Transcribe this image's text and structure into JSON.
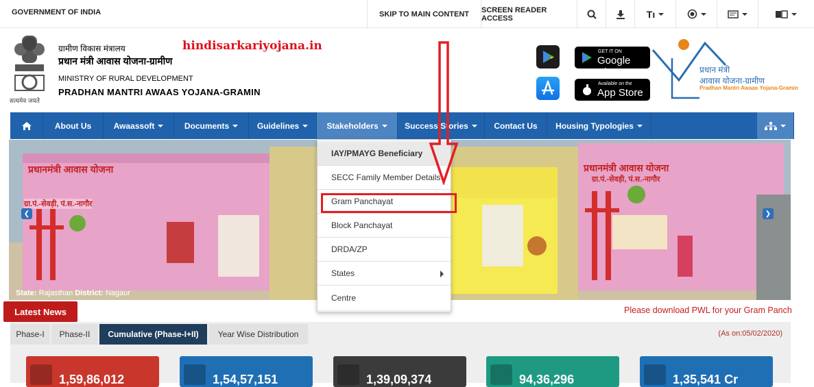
{
  "topbar": {
    "government": "GOVERNMENT OF INDIA",
    "skip": "SKIP TO MAIN CONTENT",
    "screen_reader": "SCREEN READER ACCESS",
    "text_size": "Tı"
  },
  "header": {
    "hindi_ministry": "ग्रामीण विकास मंत्रालय",
    "hindi_scheme": "प्रधान मंत्री आवास योजना-ग्रामीण",
    "ministry": "MINISTRY OF RURAL DEVELOPMENT",
    "scheme": "PRADHAN MANTRI AWAAS YOJANA-GRAMIN",
    "emblem_motto": "सत्यमेव जयते",
    "watermark": "hindisarkariyojana.in",
    "google_play_small": "GET IT ON",
    "google_play_big": "Google Play",
    "app_store_small": "Available on the",
    "app_store_big": "App Store",
    "logo_line1": "प्रधान मंत्री",
    "logo_line2": "आवास योजना-ग्रामीण",
    "logo_line3": "Pradhan Mantri Awaas Yojana-Gramin"
  },
  "nav": {
    "items": [
      {
        "label": "About Us",
        "caret": false
      },
      {
        "label": "Awaassoft",
        "caret": true
      },
      {
        "label": "Documents",
        "caret": true
      },
      {
        "label": "Guidelines",
        "caret": true
      },
      {
        "label": "Stakeholders",
        "caret": true
      },
      {
        "label": "Success Stories",
        "caret": true
      },
      {
        "label": "Contact Us",
        "caret": false
      },
      {
        "label": "Housing Typologies",
        "caret": true
      }
    ]
  },
  "dropdown": {
    "items": [
      "IAY/PMAYG Beneficiary",
      "SECC Family Member Details",
      "Gram Panchayat",
      "Block Panchayat",
      "DRDA/ZP",
      "States",
      "Centre"
    ]
  },
  "banner": {
    "state_label": "State:",
    "state": "Rajasthan",
    "district_label": "District:",
    "district": "Nagaur",
    "house_text": "प्रधानमंत्री आवास योजना",
    "house_subtext": "ग्रा.पं.-सेवड़ी, पं.स.-नागौर"
  },
  "latest_news": "Latest News",
  "ticker": "Please download PWL for your Gram Panch",
  "tabs": [
    "Phase-I",
    "Phase-II",
    "Cumulative (Phase-I+II)",
    "Year Wise Distribution"
  ],
  "as_on": "(As on:05/02/2020)",
  "cards": [
    {
      "value": "1,59,86,012",
      "color": "#c9372c"
    },
    {
      "value": "1,54,57,151",
      "color": "#1f6fb5"
    },
    {
      "value": "1,39,09,374",
      "color": "#3b3b3b"
    },
    {
      "value": "94,36,296",
      "color": "#1e9a83"
    },
    {
      "value": "1,35,541 Cr",
      "color": "#1f6fb5"
    }
  ],
  "colors": {
    "nav": "#2063ac",
    "accent_red": "#e31e24"
  }
}
